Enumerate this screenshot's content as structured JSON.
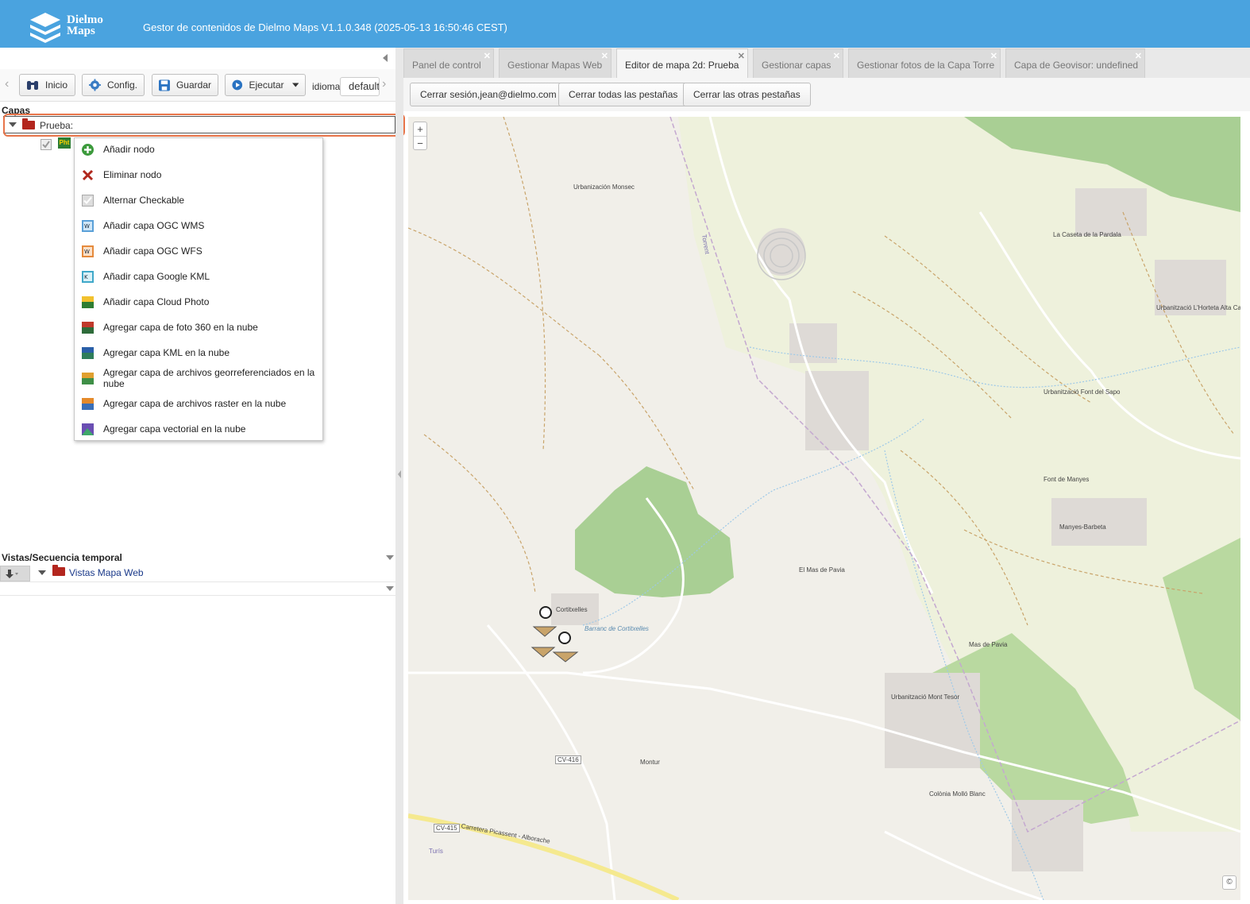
{
  "header": {
    "logo_text_1": "Dielmo",
    "logo_text_2": "Maps",
    "title": "Gestor de contenidos de Dielmo Maps V1.1.0.348 (2025-05-13 16:50:46 CEST)"
  },
  "toolbar": {
    "inicio": "Inicio",
    "config": "Config.",
    "guardar": "Guardar",
    "ejecutar": "Ejecutar",
    "idioma_label": "idioma:",
    "idioma_value": "default"
  },
  "layers": {
    "section_label": "Capas",
    "root_node": "Prueba:",
    "child_icon_text": "Pht"
  },
  "context_menu": {
    "items": [
      {
        "label": "Añadir nodo",
        "icon": "add-circle-icon"
      },
      {
        "label": "Eliminar nodo",
        "icon": "delete-x-icon"
      },
      {
        "label": "Alternar Checkable",
        "icon": "checkbox-icon"
      },
      {
        "label": "Añadir capa OGC WMS",
        "icon": "wms-layer-icon"
      },
      {
        "label": "Añadir capa OGC WFS",
        "icon": "wfs-layer-icon"
      },
      {
        "label": "Añadir capa Google KML",
        "icon": "kml-layer-icon"
      },
      {
        "label": "Añadir capa Cloud Photo",
        "icon": "cloud-photo-icon"
      },
      {
        "label": "Agregar capa de foto 360 en la nube",
        "icon": "photo360-icon"
      },
      {
        "label": "Agregar capa KML en la nube",
        "icon": "cloud-kml-icon"
      },
      {
        "label": "Agregar capa de archivos georreferenciados en la nube",
        "icon": "georef-files-icon"
      },
      {
        "label": "Agregar capa de archivos raster en la nube",
        "icon": "raster-files-icon"
      },
      {
        "label": "Agregar capa vectorial en la nube",
        "icon": "vector-layer-icon"
      }
    ]
  },
  "views": {
    "section_label": "Vistas/Secuencia temporal",
    "root_node": "Vistas Mapa Web"
  },
  "tabs": [
    {
      "label": "Panel de control",
      "active": false
    },
    {
      "label": "Gestionar Mapas Web",
      "active": false
    },
    {
      "label": "Editor de mapa 2d: Prueba",
      "active": true
    },
    {
      "label": "Gestionar capas",
      "active": false
    },
    {
      "label": "Gestionar fotos de la Capa Torre",
      "active": false
    },
    {
      "label": "Capa de Geovisor: undefined",
      "active": false
    }
  ],
  "actions": {
    "logout": "Cerrar sesión,jean@dielmo.com",
    "close_all": "Cerrar todas las pestañas",
    "close_others": "Cerrar las otras pestañas"
  },
  "map": {
    "zoom_in": "+",
    "zoom_out": "−",
    "attribution": "©",
    "labels": [
      "Urbanización Monsec",
      "La Caseta de la Pardala",
      "Urbanització L'Horteta Alta Camp",
      "Urbanització Font del Sapo",
      "Font de Manyes",
      "Manyes-Barbeta",
      "El Mas de Pavia",
      "Mas de Pavia",
      "Urbanització Mont Tesor",
      "Montur",
      "Colònia Molló Blanc",
      "CV-416",
      "CV-415",
      "Carretera Picassent - Alborache",
      "Torrent",
      "Turís",
      "Barranc de Cortitxelles",
      "Cortitxelles"
    ]
  },
  "colors": {
    "header_bg": "#4aa3df",
    "highlight": "#e8754a",
    "folder": "#b3261e",
    "map_bg": "#f1efe9",
    "forest": "#a4c98c"
  }
}
